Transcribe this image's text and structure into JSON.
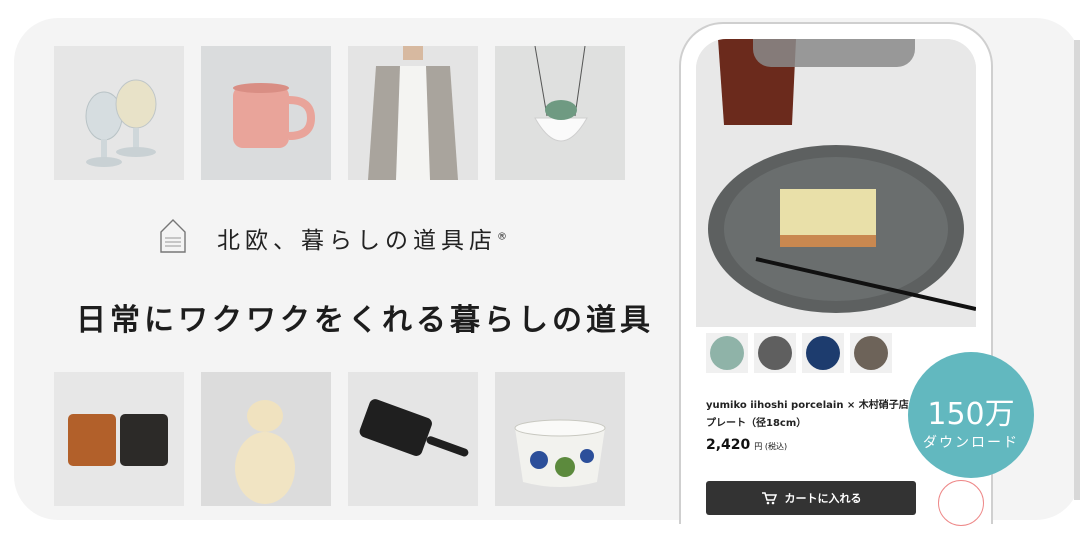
{
  "brand": {
    "name": "北欧、暮らしの道具店",
    "trademark": "®"
  },
  "tagline": "日常にワクワクをくれる暮らしの道具",
  "product": {
    "name_line1": "yumiko iihoshi porcelain × 木村硝子店 /",
    "name_line2": "プレート（径18cm）",
    "price": "2,420",
    "price_unit": "円 (税込)",
    "cart_label": "カートに入れる"
  },
  "badge": {
    "count": "150万",
    "label": "ダウンロード"
  },
  "colors": {
    "badge": "#62b8bf",
    "cart_button": "#333333",
    "card_bg": "#f4f4f4"
  },
  "swatch_colors": [
    "#8fb3a8",
    "#5f5f5f",
    "#1d3c6e",
    "#6d6359"
  ],
  "tiles_top": [
    "glasses",
    "mug",
    "cardigan",
    "hanging-planter"
  ],
  "tiles_bottom": [
    "wallets",
    "bear-figurine",
    "skillet",
    "floral-bowl"
  ]
}
